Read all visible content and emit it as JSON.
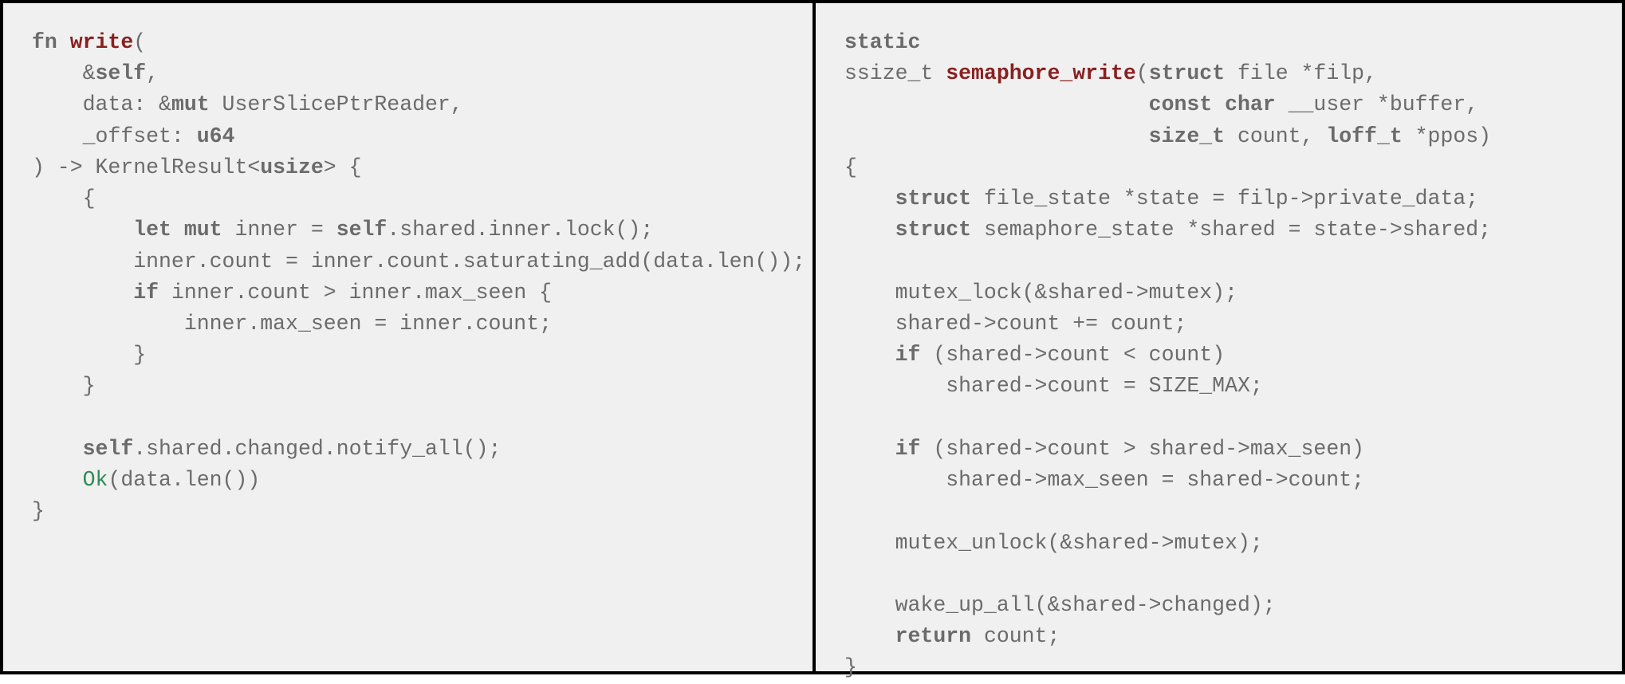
{
  "panes": {
    "left": {
      "language": "Rust",
      "tokens": [
        {
          "t": "fn ",
          "c": "kw"
        },
        {
          "t": "write",
          "c": "fn"
        },
        {
          "t": "(\n"
        },
        {
          "t": "    &"
        },
        {
          "t": "self",
          "c": "kw"
        },
        {
          "t": ",\n"
        },
        {
          "t": "    data: &"
        },
        {
          "t": "mut",
          "c": "kw"
        },
        {
          "t": " UserSlicePtrReader,\n"
        },
        {
          "t": "    _offset: "
        },
        {
          "t": "u64",
          "c": "kw"
        },
        {
          "t": "\n"
        },
        {
          "t": ") -> KernelResult<"
        },
        {
          "t": "usize",
          "c": "kw"
        },
        {
          "t": "> {\n"
        },
        {
          "t": "    {\n"
        },
        {
          "t": "        "
        },
        {
          "t": "let mut",
          "c": "kw"
        },
        {
          "t": " inner = "
        },
        {
          "t": "self",
          "c": "kw"
        },
        {
          "t": ".shared.inner.lock();\n"
        },
        {
          "t": "        inner.count = inner.count.saturating_add(data.len());\n"
        },
        {
          "t": "        "
        },
        {
          "t": "if",
          "c": "kw"
        },
        {
          "t": " inner.count > inner.max_seen {\n"
        },
        {
          "t": "            inner.max_seen = inner.count;\n"
        },
        {
          "t": "        }\n"
        },
        {
          "t": "    }\n"
        },
        {
          "t": "\n"
        },
        {
          "t": "    "
        },
        {
          "t": "self",
          "c": "kw"
        },
        {
          "t": ".shared.changed.notify_all();\n"
        },
        {
          "t": "    "
        },
        {
          "t": "Ok",
          "c": "ok"
        },
        {
          "t": "(data.len())\n"
        },
        {
          "t": "}\n"
        }
      ]
    },
    "right": {
      "language": "C",
      "tokens": [
        {
          "t": "static",
          "c": "kw"
        },
        {
          "t": "\n"
        },
        {
          "t": "ssize_t "
        },
        {
          "t": "semaphore_write",
          "c": "fn"
        },
        {
          "t": "("
        },
        {
          "t": "struct",
          "c": "kw"
        },
        {
          "t": " file *filp,\n"
        },
        {
          "t": "                        "
        },
        {
          "t": "const char",
          "c": "kw"
        },
        {
          "t": " __user *buffer,\n"
        },
        {
          "t": "                        "
        },
        {
          "t": "size_t",
          "c": "kw"
        },
        {
          "t": " count, "
        },
        {
          "t": "loff_t",
          "c": "kw"
        },
        {
          "t": " *ppos)\n"
        },
        {
          "t": "{\n"
        },
        {
          "t": "    "
        },
        {
          "t": "struct",
          "c": "kw"
        },
        {
          "t": " file_state *state = filp->private_data;\n"
        },
        {
          "t": "    "
        },
        {
          "t": "struct",
          "c": "kw"
        },
        {
          "t": " semaphore_state *shared = state->shared;\n"
        },
        {
          "t": "\n"
        },
        {
          "t": "    mutex_lock(&shared->mutex);\n"
        },
        {
          "t": "    shared->count += count;\n"
        },
        {
          "t": "    "
        },
        {
          "t": "if",
          "c": "kw"
        },
        {
          "t": " (shared->count < count)\n"
        },
        {
          "t": "        shared->count = SIZE_MAX;\n"
        },
        {
          "t": "\n"
        },
        {
          "t": "    "
        },
        {
          "t": "if",
          "c": "kw"
        },
        {
          "t": " (shared->count > shared->max_seen)\n"
        },
        {
          "t": "        shared->max_seen = shared->count;\n"
        },
        {
          "t": "\n"
        },
        {
          "t": "    mutex_unlock(&shared->mutex);\n"
        },
        {
          "t": "\n"
        },
        {
          "t": "    wake_up_all(&shared->changed);\n"
        },
        {
          "t": "    "
        },
        {
          "t": "return",
          "c": "kw"
        },
        {
          "t": " count;\n"
        },
        {
          "t": "}\n"
        }
      ]
    }
  }
}
